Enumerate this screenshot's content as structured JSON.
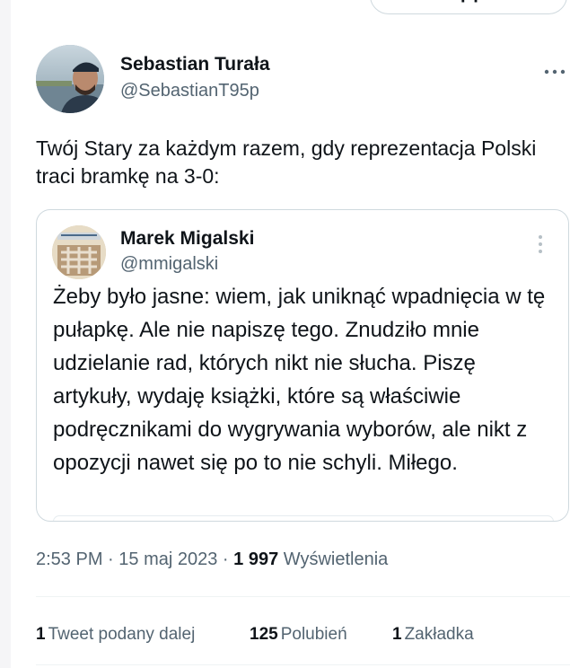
{
  "top_pill": {
    "label": "· ·"
  },
  "tweet": {
    "author": {
      "name": "Sebastian Turała",
      "handle": "@SebastianT95p"
    },
    "more_icon": "more-horizontal-icon",
    "text": "Twój Stary za każdym razem, gdy reprezentacja Polski traci bramkę na 3-0:",
    "quote": {
      "author": {
        "name": "Marek Migalski",
        "handle": "@mmigalski"
      },
      "more_icon": "more-vertical-icon",
      "text": "Żeby było jasne: wiem, jak uniknąć wpadnięcia w tę pułapkę. Ale nie napiszę tego. Znudziło mnie udzielanie rad, których nikt nie słucha. Piszę artykuły, wydaję książki, które są właściwie podręcznikami do wygrywania wyborów, ale nikt z opozycji nawet się po to nie schyli. Miłego."
    },
    "meta": {
      "time": "2:53 PM",
      "sep1": "·",
      "date": "15 maj 2023",
      "sep2": "·",
      "views_count": "1 997",
      "views_label": "Wyświetlenia"
    },
    "stats": {
      "retweets_count": "1",
      "retweets_label": "Tweet podany dalej",
      "likes_count": "125",
      "likes_label": "Polubień",
      "bookmarks_count": "1",
      "bookmarks_label": "Zakładka"
    }
  }
}
